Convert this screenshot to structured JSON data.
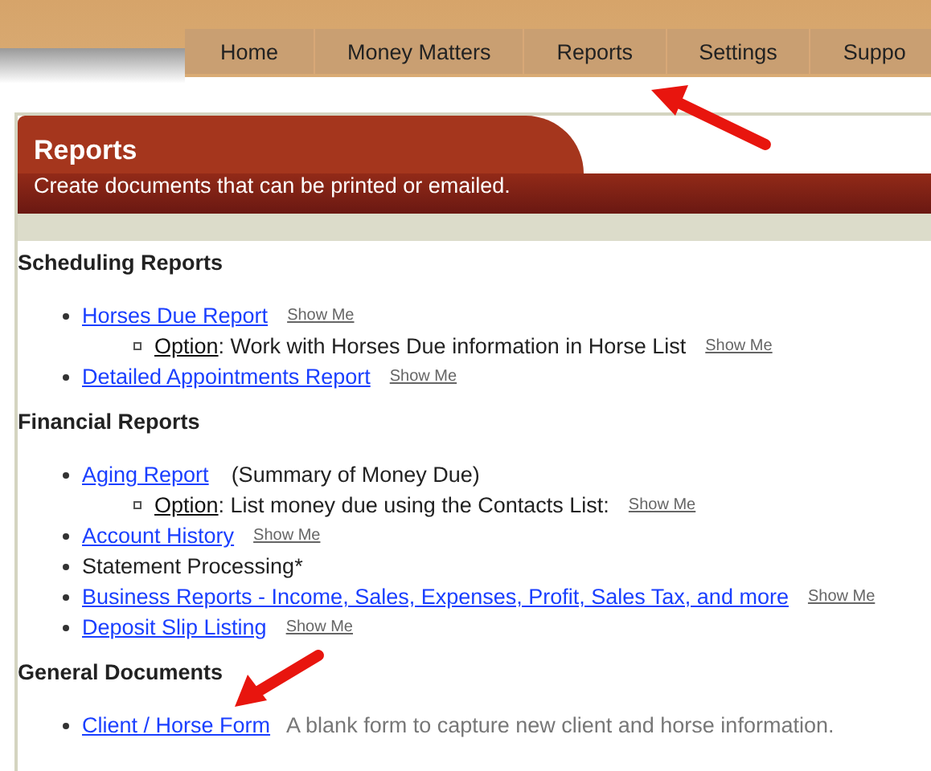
{
  "tabs": [
    {
      "label": "Home"
    },
    {
      "label": "Money Matters"
    },
    {
      "label": "Reports"
    },
    {
      "label": "Settings"
    },
    {
      "label": "Suppo"
    }
  ],
  "header": {
    "title": "Reports",
    "subtitle": "Create documents that can be printed or emailed."
  },
  "sections": [
    {
      "title": "Scheduling Reports",
      "items": [
        {
          "kind": "link",
          "label": "Horses Due Report",
          "show_me": "Show Me",
          "children": [
            {
              "label": "Option",
              "text": ": Work with Horses Due information in Horse List",
              "show_me": "Show Me"
            }
          ]
        },
        {
          "kind": "link",
          "label": "Detailed Appointments Report",
          "show_me": "Show Me"
        }
      ]
    },
    {
      "title": "Financial Reports",
      "items": [
        {
          "kind": "link",
          "label": "Aging Report",
          "note": "(Summary of Money Due)",
          "note_muted": false,
          "children": [
            {
              "label": "Option",
              "text": ": List money due using the Contacts List:",
              "show_me": "Show Me"
            }
          ]
        },
        {
          "kind": "link",
          "label": "Account History",
          "show_me": "Show Me"
        },
        {
          "kind": "text",
          "label": "Statement Processing*"
        },
        {
          "kind": "link",
          "label": "Business Reports - Income, Sales, Expenses, Profit, Sales Tax, and more",
          "show_me": "Show Me"
        },
        {
          "kind": "link",
          "label": "Deposit Slip Listing",
          "show_me": "Show Me"
        }
      ]
    },
    {
      "title": "General Documents",
      "items": [
        {
          "kind": "link",
          "label": "Client / Horse Form",
          "note": "A blank form to capture new client and horse information.",
          "note_muted": true
        }
      ]
    }
  ]
}
